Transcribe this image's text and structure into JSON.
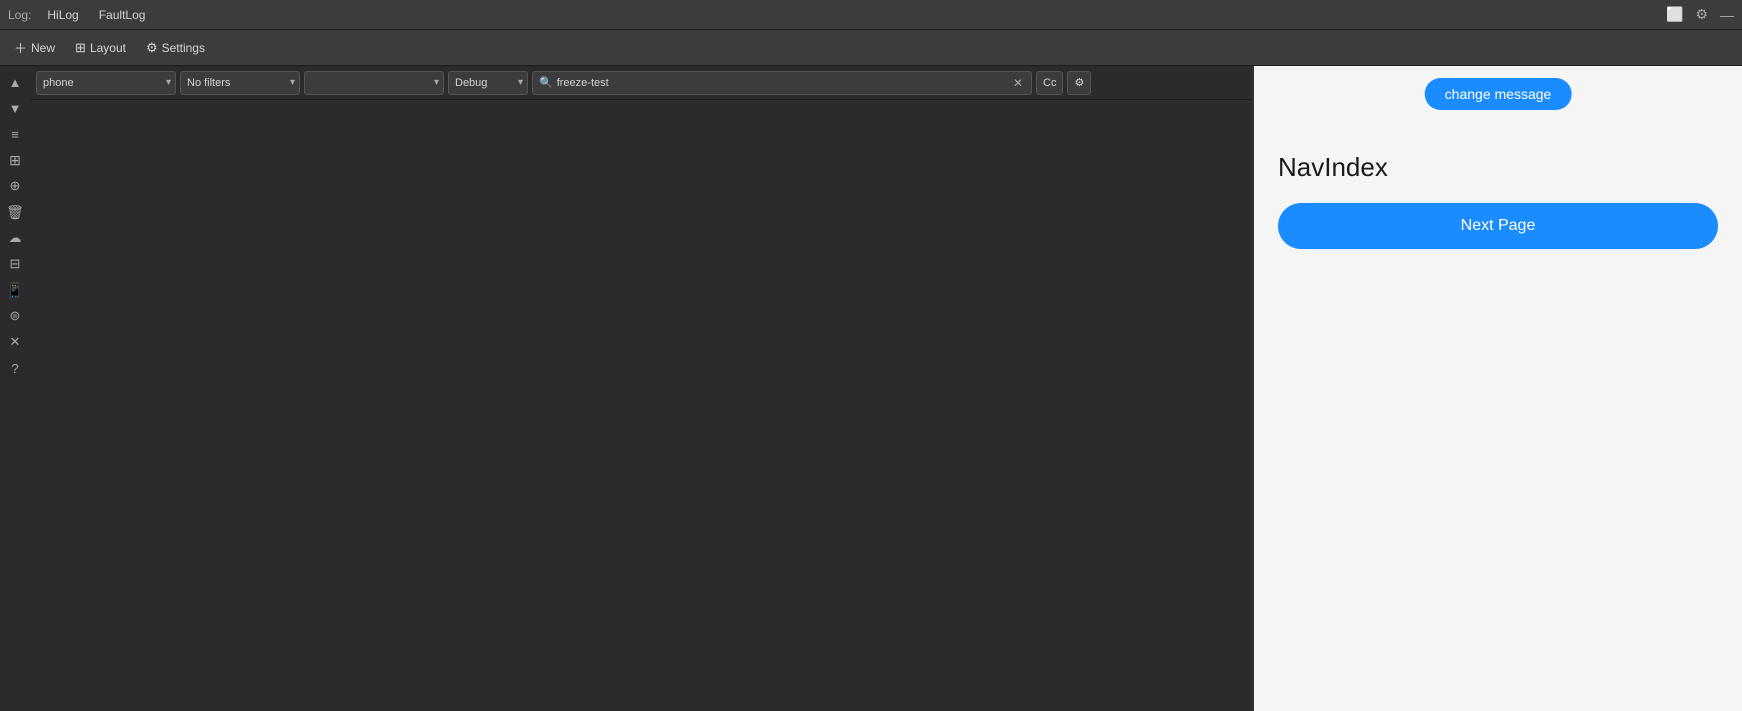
{
  "menubar": {
    "label": "Log:",
    "items": [
      {
        "id": "hilog",
        "label": "HiLog"
      },
      {
        "id": "faultlog",
        "label": "FaultLog"
      }
    ]
  },
  "toolbar": {
    "new_label": "New",
    "layout_label": "Layout",
    "settings_label": "Settings"
  },
  "filterbar": {
    "device_value": "phone",
    "device_placeholder": "phone",
    "filter_value": "No filters",
    "tag_placeholder": "",
    "level_value": "Debug",
    "search_value": "freeze-test",
    "search_placeholder": "freeze-test",
    "cc_label": "Cc"
  },
  "phone_preview": {
    "change_message_label": "change message",
    "nav_index_title": "NavIndex",
    "next_page_label": "Next Page"
  },
  "sidebar_icons": [
    {
      "id": "scroll-up",
      "symbol": "▲"
    },
    {
      "id": "scroll-down",
      "symbol": "▼"
    },
    {
      "id": "filter-lines",
      "symbol": "≡"
    },
    {
      "id": "add-filter",
      "symbol": "⊞"
    },
    {
      "id": "bookmark",
      "symbol": "⊕"
    },
    {
      "id": "delete",
      "symbol": "🗑"
    },
    {
      "id": "cloud",
      "symbol": "☁"
    },
    {
      "id": "table",
      "symbol": "⊟"
    },
    {
      "id": "phone-icon",
      "symbol": "📱"
    },
    {
      "id": "sliders",
      "symbol": "⊜"
    },
    {
      "id": "close",
      "symbol": "✕"
    },
    {
      "id": "help",
      "symbol": "?"
    }
  ],
  "window_controls": {
    "maximize": "⬜",
    "settings": "⚙",
    "minimize": "—"
  }
}
